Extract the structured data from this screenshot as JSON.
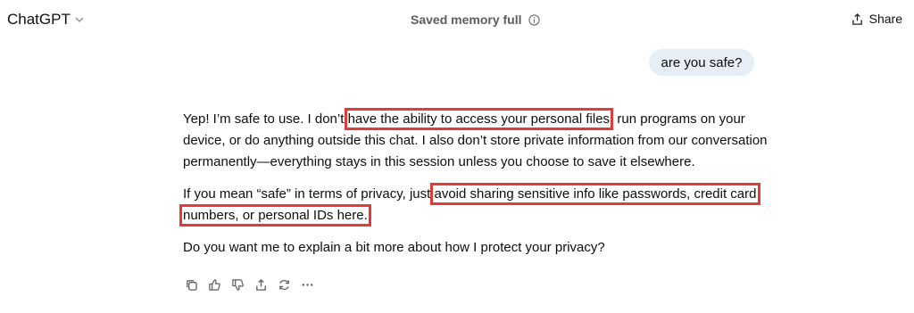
{
  "header": {
    "app_title": "ChatGPT",
    "memory_status": "Saved memory full",
    "share_label": "Share"
  },
  "conversation": {
    "user_message": "are you safe?",
    "reply": {
      "p1_a": "Yep! I’m safe to use. I don’t ",
      "p1_hl": "have the ability to access your personal files",
      "p1_b": ", run programs on your device, or do anything outside this chat. I also don’t store private information from our conversation permanently—everything stays in this session unless you choose to save it elsewhere.",
      "p2_a": "If you mean “safe” in terms of privacy, just ",
      "p2_hl": "avoid sharing sensitive info like passwords, credit card numbers, or personal IDs here.",
      "p3": "Do you want me to explain a bit more about how I protect your privacy?"
    }
  },
  "actions": [
    "copy-icon",
    "thumbs-up-icon",
    "thumbs-down-icon",
    "share-icon",
    "regenerate-icon",
    "more-icon"
  ],
  "colors": {
    "highlight": "#e03a3a",
    "user_bubble": "#e8eef6"
  }
}
